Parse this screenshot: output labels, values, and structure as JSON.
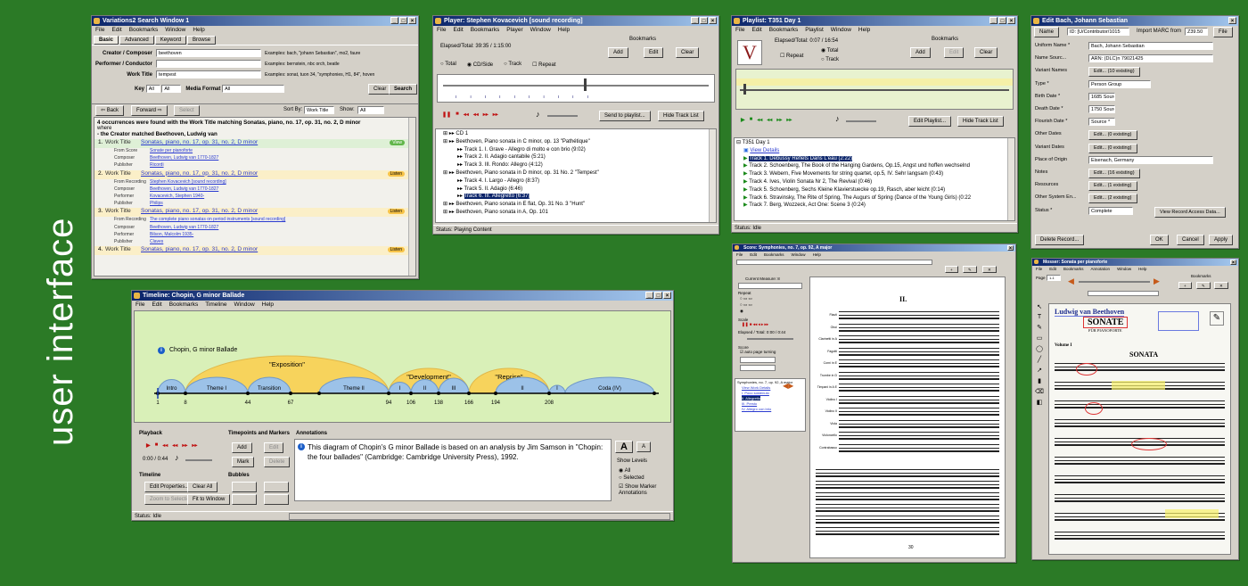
{
  "slide": {
    "title": "user interface"
  },
  "search": {
    "title": "Variations2 Search Window 1",
    "menus": [
      "File",
      "Edit",
      "Bookmarks",
      "Window",
      "Help"
    ],
    "tabs": [
      "Basic",
      "Advanced",
      "Keyword",
      "Browse"
    ],
    "fields": [
      {
        "label": "Creator / Composer",
        "value": "beethoven",
        "example": "Examples: bach, \"johann Sebastian\", mo2, faure"
      },
      {
        "label": "Performer / Conductor",
        "value": "",
        "example": "Examples: bernstein, nbc orch, beatle"
      },
      {
        "label": "Work Title",
        "value": "tempest",
        "example": "Examples: sonat, tuon 34, \"symphonies, H1, 84\", hoven"
      }
    ],
    "key_label": "Key",
    "key1": "All",
    "key2": "All",
    "media_label": "Media Format",
    "media_value": "All",
    "clear_label": "Clear",
    "search_label": "Search",
    "back_label": "Back",
    "forward_label": "Forward",
    "select_label": "Select",
    "sortby_label": "Sort By:",
    "sortby_value": "Work Title",
    "show_label": "Show:",
    "show_value": "All",
    "result_line1": "4 occurrences were found with the Work Title matching Sonatas, piano, no. 17, op. 31, no. 2, D minor",
    "result_where": "where",
    "result_line2": "- the Creator matched Beethoven, Ludwig van",
    "results": [
      {
        "num": "1.",
        "type": "Work Title",
        "title": "Sonatas, piano, no. 17, op. 31, no. 2, D minor",
        "badge": "View"
      },
      {
        "num": "",
        "type": "From Score",
        "title": "Sonate per pianoforte",
        "badge": ""
      },
      {
        "num": "",
        "type": "Composer",
        "title": "Beethoven, Ludwig van 1770-1827",
        "badge": ""
      },
      {
        "num": "",
        "type": "Publisher",
        "title": "Ricordi",
        "badge": ""
      },
      {
        "num": "2.",
        "type": "Work Title",
        "title": "Sonatas, piano, no. 17, op. 31, no. 2, D minor",
        "badge": "Listen"
      },
      {
        "num": "",
        "type": "From Recording",
        "title": "Stephen Kovacevich [sound recording]",
        "badge": ""
      },
      {
        "num": "",
        "type": "Composer",
        "title": "Beethoven, Ludwig van 1770-1827",
        "badge": ""
      },
      {
        "num": "",
        "type": "Performer",
        "title": "Kovacevich, Stephen 1940-",
        "badge": ""
      },
      {
        "num": "",
        "type": "Publisher",
        "title": "Philips",
        "badge": ""
      },
      {
        "num": "3.",
        "type": "Work Title",
        "title": "Sonatas, piano, no. 17, op. 31, no. 2, D minor",
        "badge": "Listen"
      },
      {
        "num": "",
        "type": "From Recording",
        "title": "The complete piano sonatas on period instruments [sound recording]",
        "badge": ""
      },
      {
        "num": "",
        "type": "Composer",
        "title": "Beethoven, Ludwig van 1770-1827",
        "badge": ""
      },
      {
        "num": "",
        "type": "Performer",
        "title": "Bilson, Malcolm 1935-",
        "badge": ""
      },
      {
        "num": "",
        "type": "Publisher",
        "title": "Claves",
        "badge": ""
      },
      {
        "num": "4.",
        "type": "Work Title",
        "title": "Sonatas, piano, no. 17, op. 31, no. 2, D minor",
        "badge": "Listen"
      }
    ]
  },
  "player": {
    "title": "Player: Stephen Kovacevich [sound recording]",
    "menus": [
      "File",
      "Edit",
      "Bookmarks",
      "Player",
      "Window",
      "Help"
    ],
    "elapsed": "Elapsed/Total: 39:35 / 1:15:00",
    "bookmarks_label": "Bookmarks",
    "add_label": "Add",
    "edit_label": "Edit",
    "clear_label": "Clear",
    "radios": [
      "Total",
      "CD/Side",
      "Track",
      "Repeat"
    ],
    "send_label": "Send to playlist...",
    "hide_label": "Hide Track List",
    "tree": [
      {
        "text": "CD 1",
        "indent": 1,
        "sel": false
      },
      {
        "text": "Beethoven, Piano sonata in C minor, op. 13 \"Pathétique\"",
        "indent": 1,
        "sel": false
      },
      {
        "text": "Track 1. I. Grave - Allegro di molto e con brio (9:02)",
        "indent": 2,
        "sel": false
      },
      {
        "text": "Track 2. II. Adagio cantabile (5:21)",
        "indent": 2,
        "sel": false
      },
      {
        "text": "Track 3. III. Rondo: Allegro (4:12)",
        "indent": 2,
        "sel": false
      },
      {
        "text": "Beethoven, Piano sonata in D minor, op. 31 No. 2 \"Tempest\"",
        "indent": 1,
        "sel": false
      },
      {
        "text": "Track 4. I. Largo - Allegro (8:37)",
        "indent": 2,
        "sel": false
      },
      {
        "text": "Track 5. II. Adagio (6:46)",
        "indent": 2,
        "sel": false
      },
      {
        "text": "Track 6. III. Allegretto (6:37)",
        "indent": 2,
        "sel": true
      },
      {
        "text": "Beethoven, Piano sonata in E flat, Op. 31 No. 3 \"Hunt\"",
        "indent": 1,
        "sel": false
      },
      {
        "text": "Beethoven, Piano sonata in A, Op. 101",
        "indent": 1,
        "sel": false
      }
    ],
    "status": "Status: Playing Content"
  },
  "playlist": {
    "title": "Playlist: T351 Day 1",
    "menus": [
      "File",
      "Edit",
      "Bookmarks",
      "Playlist",
      "Window",
      "Help"
    ],
    "elapsed": "Elapsed/Total: 0:07 / 16:54",
    "bookmarks_label": "Bookmarks",
    "add_label": "Add",
    "edit_label": "Edit",
    "clear_label": "Clear",
    "total_label": "Total",
    "track_label": "Track",
    "repeat_label": "Repeat",
    "editplaylist_label": "Edit Playlist...",
    "hide_label": "Hide Track List",
    "list_title": "T351 Day 1",
    "view_details": "View Details",
    "tracks": [
      {
        "text": "Track 1. Debussy Reflets Dans L'eau (2:22)",
        "sel": true
      },
      {
        "text": "Track 2. Schoenberg, The Book of the Hanging Gardens, Op.15, Angst und hoffen wechselnd",
        "sel": false
      },
      {
        "text": "Track 3. Webern, Five Movements for string quartet, op.5, IV. Sehr langsam (0:43)",
        "sel": false
      },
      {
        "text": "Track 4. Ives, Violin Sonata Nr 2, The Revival (0:46)",
        "sel": false
      },
      {
        "text": "Track 5. Schoenberg, Sechs Kleine Klavierstuecke op.19, Rasch, aber leicht (0:14)",
        "sel": false
      },
      {
        "text": "Track 6. Stravinsky, The Rite of Spring, The Augurs of Spring (Dance of the Young Girls) (0:22",
        "sel": false
      },
      {
        "text": "Track 7. Berg, Wozzeck, Act One: Scene 3 (0:24)",
        "sel": false
      }
    ],
    "status": "Status: Idle"
  },
  "editor": {
    "title": "Edit Bach, Johann Sebastian",
    "name_btn": "Name",
    "id_value": "ID: [U/Contributor/1015",
    "import_label": "Import MARC from",
    "import_value": "Z39.50",
    "file_label": "File",
    "rows": [
      {
        "label": "Uniform Name *",
        "value": "Bach, Johann Sebastian"
      },
      {
        "label": "Name Sourc...",
        "value": "ARN: (DLC)n 79021425"
      },
      {
        "label": "Variant Names",
        "value": "Edit...   (10 existing)"
      },
      {
        "label": "Type *",
        "value": "Person   Group"
      },
      {
        "label": "Birth Date *",
        "value": "1685     Source * ARN: (DLC)n 79021425"
      },
      {
        "label": "Death Date *",
        "value": "1750     Source * ARN: (DLC)n 79021425"
      },
      {
        "label": "Flourish Date *",
        "value": "         Source *"
      },
      {
        "label": "Other Dates",
        "value": "Edit...   (0 existing)"
      },
      {
        "label": "Variant Dates",
        "value": "Edit...   (0 existing)"
      },
      {
        "label": "Place of Origin",
        "value": "Eisenach, Germany"
      },
      {
        "label": "Notes",
        "value": "Edit...   (16 existing)"
      },
      {
        "label": "Resources",
        "value": "Edit...   (1 existing)"
      },
      {
        "label": "Other System En...",
        "value": "Edit...   (2 existing)"
      },
      {
        "label": "Status *",
        "value": "Complete"
      }
    ],
    "view_access": "View Record Access Data...",
    "delete_label": "Delete Record...",
    "ok_label": "OK",
    "cancel_label": "Cancel",
    "apply_label": "Apply"
  },
  "timeline": {
    "title": "Timeline: Chopin, G minor Ballade",
    "menus": [
      "File",
      "Edit",
      "Bookmarks",
      "Timeline",
      "Window",
      "Help"
    ],
    "heading": "Chopin, G minor Ballade",
    "arcs": [
      {
        "label": "\"Exposition\""
      },
      {
        "label": "\"Development\""
      },
      {
        "label": "\"Reprise\""
      }
    ],
    "segments": [
      "Intro",
      "Theme I",
      "Transition",
      "Theme II",
      "I",
      "II",
      "III",
      "II",
      "I",
      "Coda (IV)"
    ],
    "measures": [
      "1",
      "8",
      "44",
      "67",
      "94",
      "106",
      "138",
      "166",
      "194",
      "208"
    ],
    "playback_label": "Playback",
    "time_value": "0:00 / 0:44",
    "timepoints_label": "Timepoints and Markers",
    "add_label": "Add",
    "edit_label": "Edit",
    "mark_label": "Mark",
    "delete_label": "Delete",
    "annotations_label": "Annotations",
    "annotation_text": "This diagram of Chopin's G minor Ballade is based on an analysis by Jim Samson in \"Chopin: the four ballades\" (Cambridge: Cambridge University Press), 1992.",
    "timeline_label": "Timeline",
    "edit_props": "Edit Properties...",
    "clear_all": "Clear All",
    "zoom_selection": "Zoom to Selection",
    "fit_window": "Fit to Window",
    "bubbles_label": "Bubbles",
    "show_levels": "Show Levels",
    "all_label": "All",
    "selected_label": "Selected",
    "show_marker": "Show Marker Annotations",
    "big_a": "A",
    "small_a": "A",
    "status": "Status: Idle"
  },
  "score_viewer": {
    "title": "Score: Symphonies, no. 7, op. 92, A major",
    "current_measure": "Current Measure: 8",
    "repeat_label": "Repeat",
    "scale_label": "Scale",
    "elapsed": "Elapsed / Total: 0:00 / 0:44",
    "score_label": "Score",
    "auto_page": "auto page turning",
    "movement": "II.",
    "tree_items": [
      "Symphonies, no. 7, op. 92, A major",
      "View Work Details",
      "I. Poco sostenuto",
      "II. Allegretto",
      "III. Presto",
      "IV. Allegro con brio"
    ],
    "instruments": [
      "Flauti",
      "Oboi",
      "Clarinetti in A",
      "Fagotti",
      "Corni in E",
      "Trombe in D",
      "Timpani in A E",
      "Violino I",
      "Violino II",
      "Viola",
      "Violoncello",
      "Contrabasso"
    ],
    "page_number": "30"
  },
  "sonata_viewer": {
    "title": "Mosser: Sonata per pianoforte",
    "page_label": "Page",
    "page_value": "1-1",
    "bookmarks_label": "Bookmarks",
    "score_header": "Ludwig van Beethoven",
    "sonate": "SONATE",
    "sonate_sub": "FÜR PIANOFORTE",
    "sonata_title": "SONATA",
    "volume": "Volume I"
  }
}
